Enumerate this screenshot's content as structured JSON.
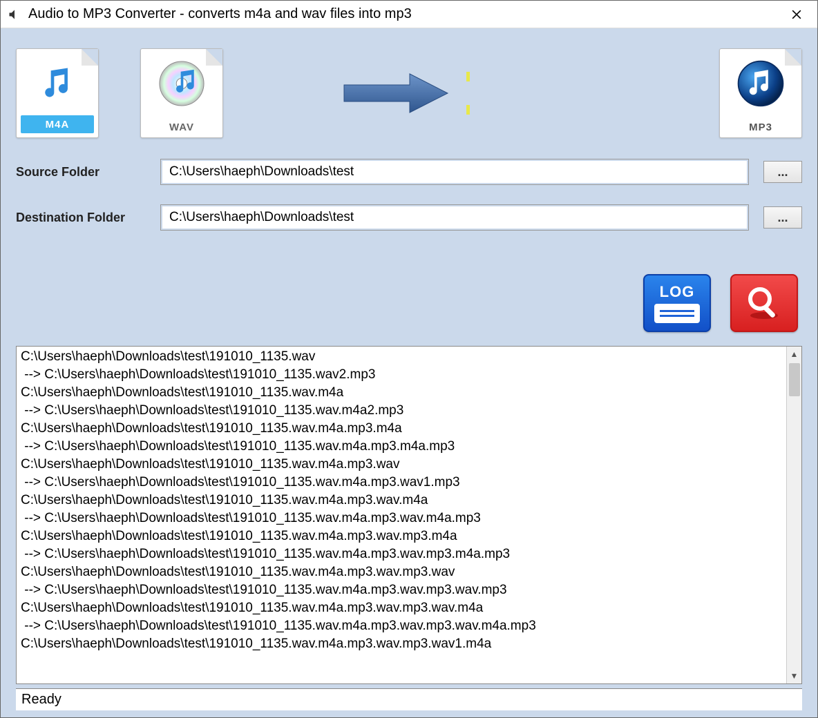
{
  "window": {
    "title": "Audio to MP3 Converter - converts m4a and wav files into mp3"
  },
  "icons": {
    "m4a_label": "M4A",
    "wav_label": "WAV",
    "mp3_label": "MP3"
  },
  "form": {
    "source_label": "Source Folder",
    "source_value": "C:\\Users\\haeph\\Downloads\\test",
    "dest_label": "Destination Folder",
    "dest_value": "C:\\Users\\haeph\\Downloads\\test",
    "browse_label": "..."
  },
  "actions": {
    "log_label": "LOG"
  },
  "output_lines": [
    "C:\\Users\\haeph\\Downloads\\test\\191010_1135.wav",
    " --> C:\\Users\\haeph\\Downloads\\test\\191010_1135.wav2.mp3",
    "C:\\Users\\haeph\\Downloads\\test\\191010_1135.wav.m4a",
    " --> C:\\Users\\haeph\\Downloads\\test\\191010_1135.wav.m4a2.mp3",
    "C:\\Users\\haeph\\Downloads\\test\\191010_1135.wav.m4a.mp3.m4a",
    " --> C:\\Users\\haeph\\Downloads\\test\\191010_1135.wav.m4a.mp3.m4a.mp3",
    "C:\\Users\\haeph\\Downloads\\test\\191010_1135.wav.m4a.mp3.wav",
    " --> C:\\Users\\haeph\\Downloads\\test\\191010_1135.wav.m4a.mp3.wav1.mp3",
    "C:\\Users\\haeph\\Downloads\\test\\191010_1135.wav.m4a.mp3.wav.m4a",
    " --> C:\\Users\\haeph\\Downloads\\test\\191010_1135.wav.m4a.mp3.wav.m4a.mp3",
    "C:\\Users\\haeph\\Downloads\\test\\191010_1135.wav.m4a.mp3.wav.mp3.m4a",
    " --> C:\\Users\\haeph\\Downloads\\test\\191010_1135.wav.m4a.mp3.wav.mp3.m4a.mp3",
    "C:\\Users\\haeph\\Downloads\\test\\191010_1135.wav.m4a.mp3.wav.mp3.wav",
    " --> C:\\Users\\haeph\\Downloads\\test\\191010_1135.wav.m4a.mp3.wav.mp3.wav.mp3",
    "C:\\Users\\haeph\\Downloads\\test\\191010_1135.wav.m4a.mp3.wav.mp3.wav.m4a",
    " --> C:\\Users\\haeph\\Downloads\\test\\191010_1135.wav.m4a.mp3.wav.mp3.wav.m4a.mp3",
    "C:\\Users\\haeph\\Downloads\\test\\191010_1135.wav.m4a.mp3.wav.mp3.wav1.m4a"
  ],
  "status": {
    "text": "Ready"
  }
}
